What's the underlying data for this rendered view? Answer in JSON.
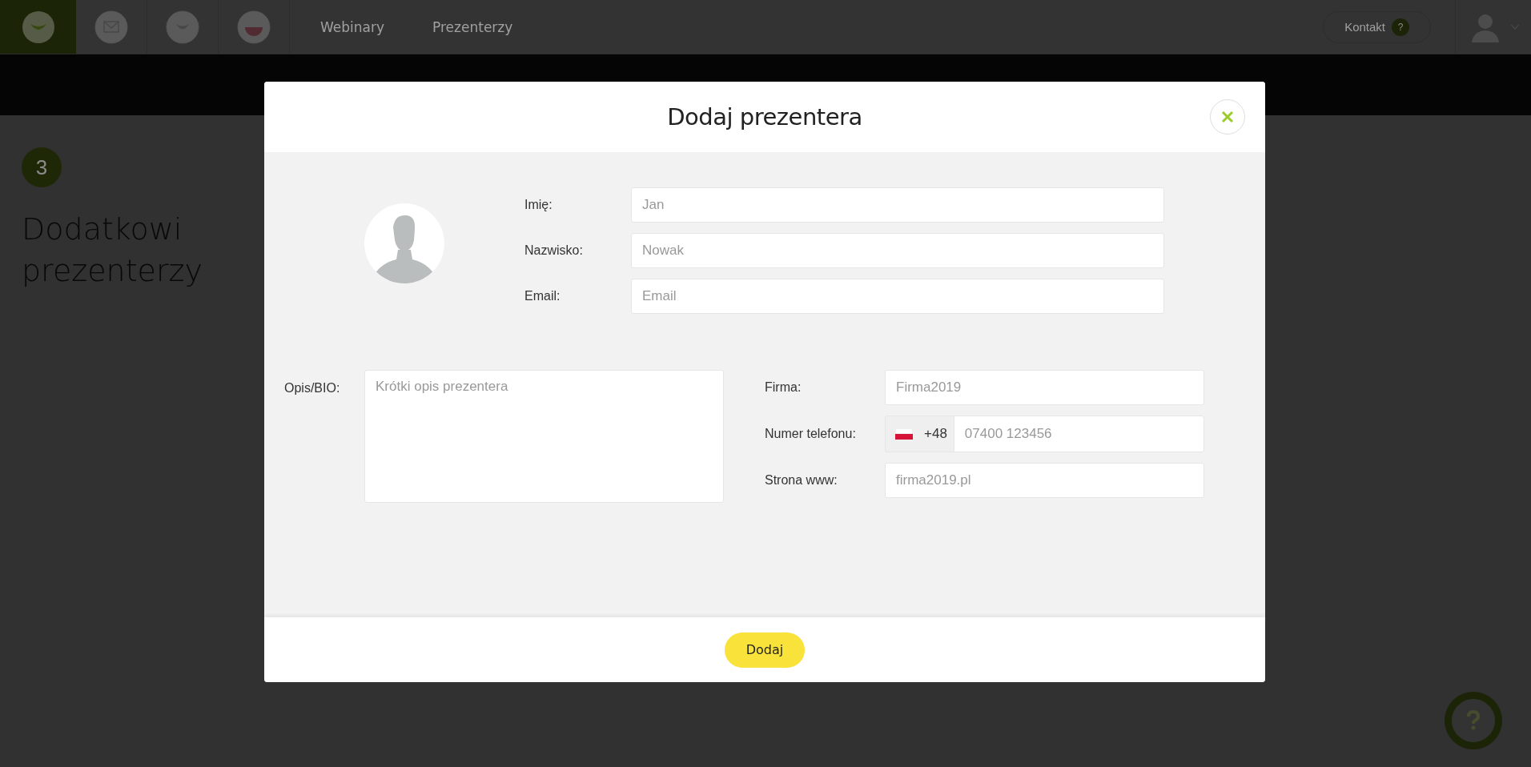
{
  "topbar": {
    "breadcrumbs": [
      "Webinary",
      "Prezenterzy"
    ],
    "contact": {
      "label": "Kontakt",
      "badge": "?"
    }
  },
  "page": {
    "step_number": "3",
    "heading": "Dodatkowi prezenterzy"
  },
  "modal": {
    "title": "Dodaj prezentera",
    "name_fields": [
      {
        "label": "Imię:",
        "placeholder": "Jan"
      },
      {
        "label": "Nazwisko:",
        "placeholder": "Nowak"
      },
      {
        "label": "Email:",
        "placeholder": "Email"
      }
    ],
    "bio": {
      "label": "Opis/BIO:",
      "placeholder": "Krótki opis prezentera"
    },
    "company_fields": [
      {
        "label": "Firma:",
        "kind": "text",
        "placeholder": "Firma2019"
      },
      {
        "label": "Numer telefonu:",
        "kind": "phone",
        "prefix": "+48",
        "placeholder": "07400 123456"
      },
      {
        "label": "Strona www:",
        "kind": "text",
        "placeholder": "firma2019.pl"
      }
    ],
    "submit": "Dodaj"
  }
}
